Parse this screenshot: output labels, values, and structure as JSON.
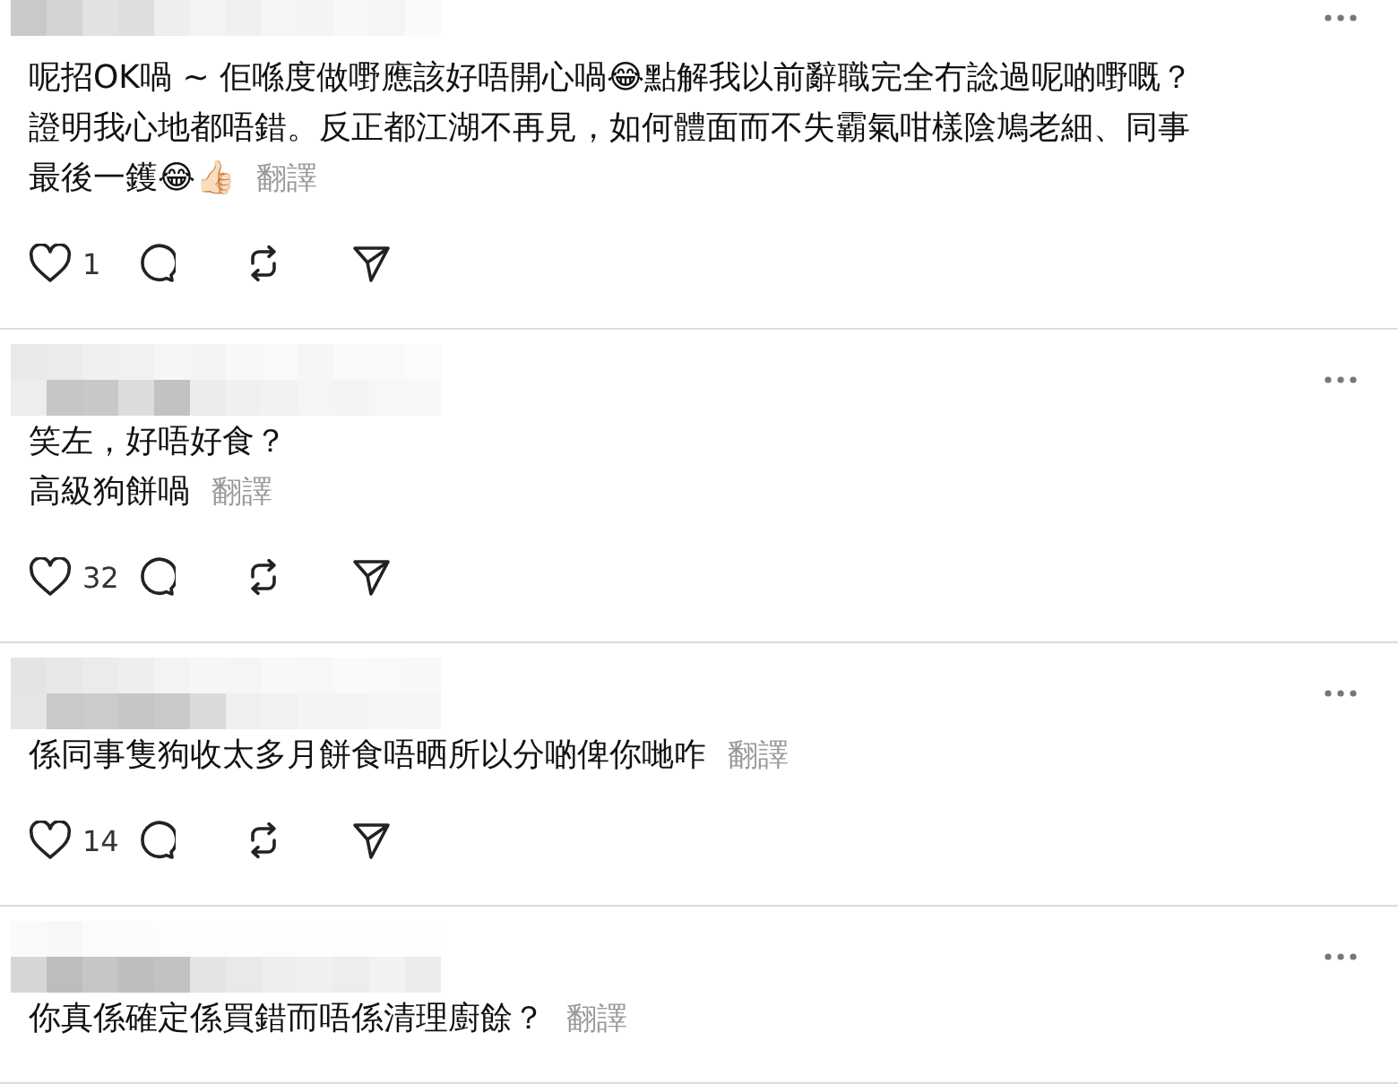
{
  "posts": [
    {
      "lines": [
        "呢招OK喎 ~ 佢喺度做嘢應該好唔開心喎😂點解我以前辭職完全冇諗過呢啲嘢嘅？",
        "證明我心地都唔錯。反正都江湖不再見，如何體面而不失霸氣咁樣陰鳩老細、同事",
        "最後一鑊😂👍🏻"
      ],
      "translate": "翻譯",
      "likes": "1"
    },
    {
      "lines": [
        "笑左，好唔好食？",
        "高級狗餅喎"
      ],
      "translate": "翻譯",
      "likes": "32"
    },
    {
      "lines": [
        "係同事隻狗收太多月餅食唔晒所以分啲俾你哋咋"
      ],
      "translate": "翻譯",
      "likes": "14"
    },
    {
      "lines": [
        "你真係確定係買錯而唔係清理廚餘？"
      ],
      "translate": "翻譯"
    }
  ]
}
